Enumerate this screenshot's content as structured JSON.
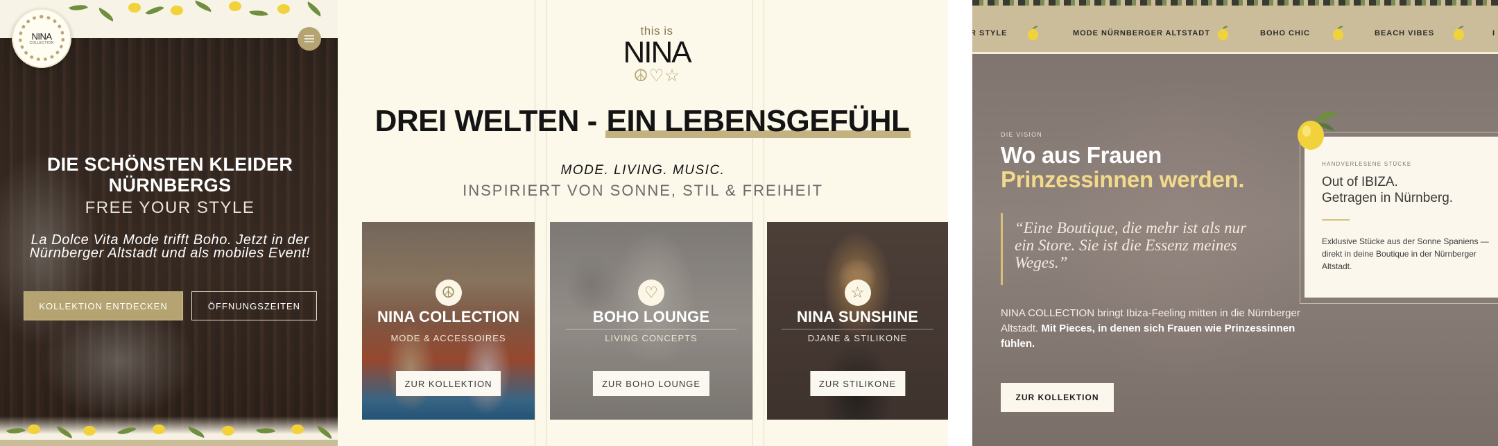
{
  "panel_mobile": {
    "logo_text": "NINA",
    "logo_sub": "COLLECTION",
    "hero_title": "DIE SCHÖNSTEN KLEIDER NÜRNBERGS",
    "hero_subtitle": "FREE YOUR STYLE",
    "hero_text": "La Dolce Vita Mode trifft Boho. Jetzt in der Nürnberger Altstadt und als mobiles Event!",
    "btn_primary": "KOLLEKTION ENTDECKEN",
    "btn_secondary": "ÖFFNUNGSZEITEN",
    "menu_icon": "hamburger-icon",
    "accent": "#b5a472"
  },
  "panel_desktop": {
    "logo_small": "this is",
    "logo_big": "NINA",
    "logo_glyphs": "☮♡☆",
    "headline_plain": "DREI WELTEN - ",
    "headline_highlight": "EIN LEBENSGEFÜHL",
    "tagline": "MODE. LIVING. MUSIC.",
    "tagline2": "INSPIRIERT VON SONNE, STIL & FREIHEIT",
    "cards": [
      {
        "icon": "☮",
        "icon_name": "peace-icon",
        "title": "NINA COLLECTION",
        "subtitle": "MODE & ACCESSOIRES",
        "button": "ZUR KOLLEKTION"
      },
      {
        "icon": "♡",
        "icon_name": "heart-icon",
        "title": "BOHO LOUNGE",
        "subtitle": "LIVING CONCEPTS",
        "button": "ZUR BOHO LOUNGE"
      },
      {
        "icon": "☆",
        "icon_name": "star-icon",
        "title": "NINA SUNSHINE",
        "subtitle": "DJANE & STILIKONE",
        "button": "ZUR STILIKONE"
      }
    ]
  },
  "panel_vision": {
    "ticker": [
      "R STYLE",
      "MODE NÜRNBERGER ALTSTADT",
      "BOHO CHIC",
      "BEACH VIBES",
      "I"
    ],
    "label": "DIE VISION",
    "heading_line1": "Wo aus Frauen",
    "heading_line2": "Prinzessinnen werden.",
    "quote": "“Eine Boutique, die mehr ist als nur ein Store. Sie ist die Essenz meines Weges.”",
    "body_plain": "NINA COLLECTION bringt Ibiza-Feeling mitten in die Nürnberger Altstadt. ",
    "body_bold": "Mit Pieces, in denen sich Frauen wie Prinzessinnen fühlen.",
    "button": "ZUR KOLLEKTION",
    "card_label": "HANDVERLESENE STÜCKE",
    "card_title_1": "Out of IBIZA.",
    "card_title_2": "Getragen in Nürnberg.",
    "card_text": "Exklusive Stücke aus der Sonne Spaniens — direkt in deine Boutique in der Nürnberger Altstadt.",
    "highlight_color": "#f3d98a"
  }
}
